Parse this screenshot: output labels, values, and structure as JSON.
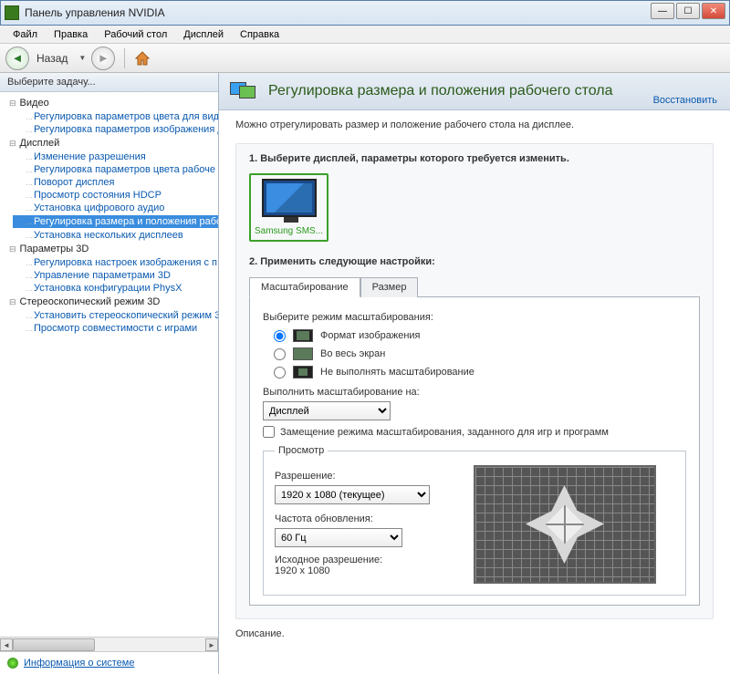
{
  "window": {
    "title": "Панель управления NVIDIA"
  },
  "menu": {
    "file": "Файл",
    "edit": "Правка",
    "desktop": "Рабочий стол",
    "display": "Дисплей",
    "help": "Справка"
  },
  "nav": {
    "back": "Назад"
  },
  "sidebar": {
    "header": "Выберите задачу...",
    "cat_video": "Видео",
    "video_items": [
      "Регулировка параметров цвета для вид",
      "Регулировка параметров изображения д"
    ],
    "cat_display": "Дисплей",
    "display_items": [
      "Изменение разрешения",
      "Регулировка параметров цвета рабоче",
      "Поворот дисплея",
      "Просмотр состояния HDCP",
      "Установка цифрового аудио",
      "Регулировка размера и положения рабо",
      "Установка нескольких дисплеев"
    ],
    "cat_3d": "Параметры 3D",
    "d3_items": [
      "Регулировка настроек изображения с п",
      "Управление параметрами 3D",
      "Установка конфигурации PhysX"
    ],
    "cat_stereo": "Стереоскопический режим 3D",
    "stereo_items": [
      "Установить стереоскопический режим 3",
      "Просмотр совместимости с играми"
    ],
    "sysinfo": "Информация о системе"
  },
  "page": {
    "title": "Регулировка размера и положения рабочего стола",
    "restore": "Восстановить",
    "intro": "Можно отрегулировать размер и положение рабочего стола на дисплее.",
    "sec1_title": "1. Выберите дисплей, параметры которого требуется изменить.",
    "display_name": "Samsung SMS...",
    "sec2_title": "2. Применить следующие настройки:",
    "tab_scale": "Масштабирование",
    "tab_size": "Размер",
    "scale_mode_label": "Выберите режим масштабирования:",
    "opt_aspect": "Формат изображения",
    "opt_full": "Во весь экран",
    "opt_none": "Не выполнять масштабирование",
    "perform_on_label": "Выполнить масштабирование на:",
    "perform_on_value": "Дисплей",
    "override_label": "Замещение режима масштабирования, заданного для игр и программ",
    "preview_legend": "Просмотр",
    "res_label": "Разрешение:",
    "res_value": "1920 x 1080 (текущее)",
    "refresh_label": "Частота обновления:",
    "refresh_value": "60 Гц",
    "native_label": "Исходное разрешение:",
    "native_value": "1920 x 1080",
    "desc_label": "Описание."
  }
}
